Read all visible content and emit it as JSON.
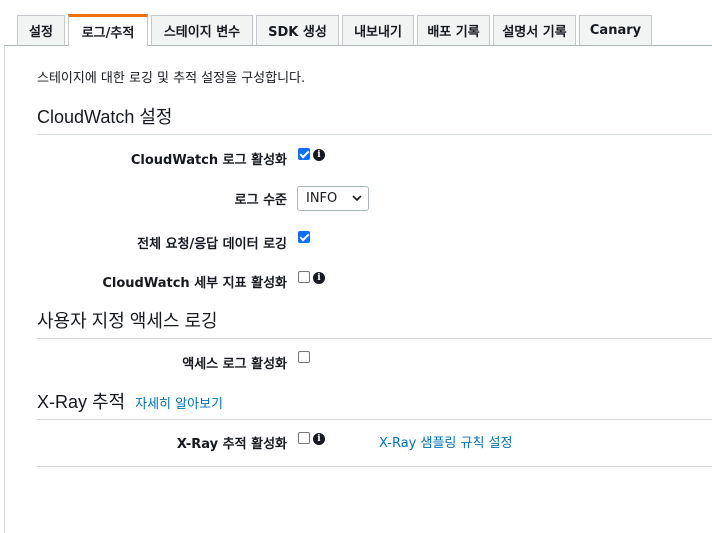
{
  "tabs": [
    {
      "label": "설정"
    },
    {
      "label": "로그/추적"
    },
    {
      "label": "스테이지 변수"
    },
    {
      "label": "SDK 생성"
    },
    {
      "label": "내보내기"
    },
    {
      "label": "배포 기록"
    },
    {
      "label": "설명서 기록"
    },
    {
      "label": "Canary"
    }
  ],
  "active_tab": "로그/추적",
  "description": "스테이지에 대한 로깅 및 추적 설정을 구성합니다.",
  "cloudwatch": {
    "title": "CloudWatch 설정",
    "enable_logs_label": "CloudWatch 로그 활성화",
    "enable_logs_checked": true,
    "log_level_label": "로그 수준",
    "log_level_value": "INFO",
    "full_request_label": "전체 요청/응답 데이터 로깅",
    "full_request_checked": true,
    "detailed_metrics_label": "CloudWatch 세부 지표 활성화",
    "detailed_metrics_checked": false
  },
  "custom_access": {
    "title": "사용자 지정 액세스 로깅",
    "enable_access_label": "액세스 로그 활성화",
    "enable_access_checked": false
  },
  "xray": {
    "title": "X-Ray 추적",
    "learn_more": "자세히 알아보기",
    "enable_label": "X-Ray 추적 활성화",
    "enable_checked": false,
    "sampling_link": "X-Ray 샘플링 규칙 설정"
  },
  "colors": {
    "accent_tab": "#ec7211",
    "link": "#0073bb",
    "checkbox_checked": "#0b6fff"
  },
  "icons": {
    "info": "info-icon",
    "chevron": "chevron-down-icon"
  }
}
